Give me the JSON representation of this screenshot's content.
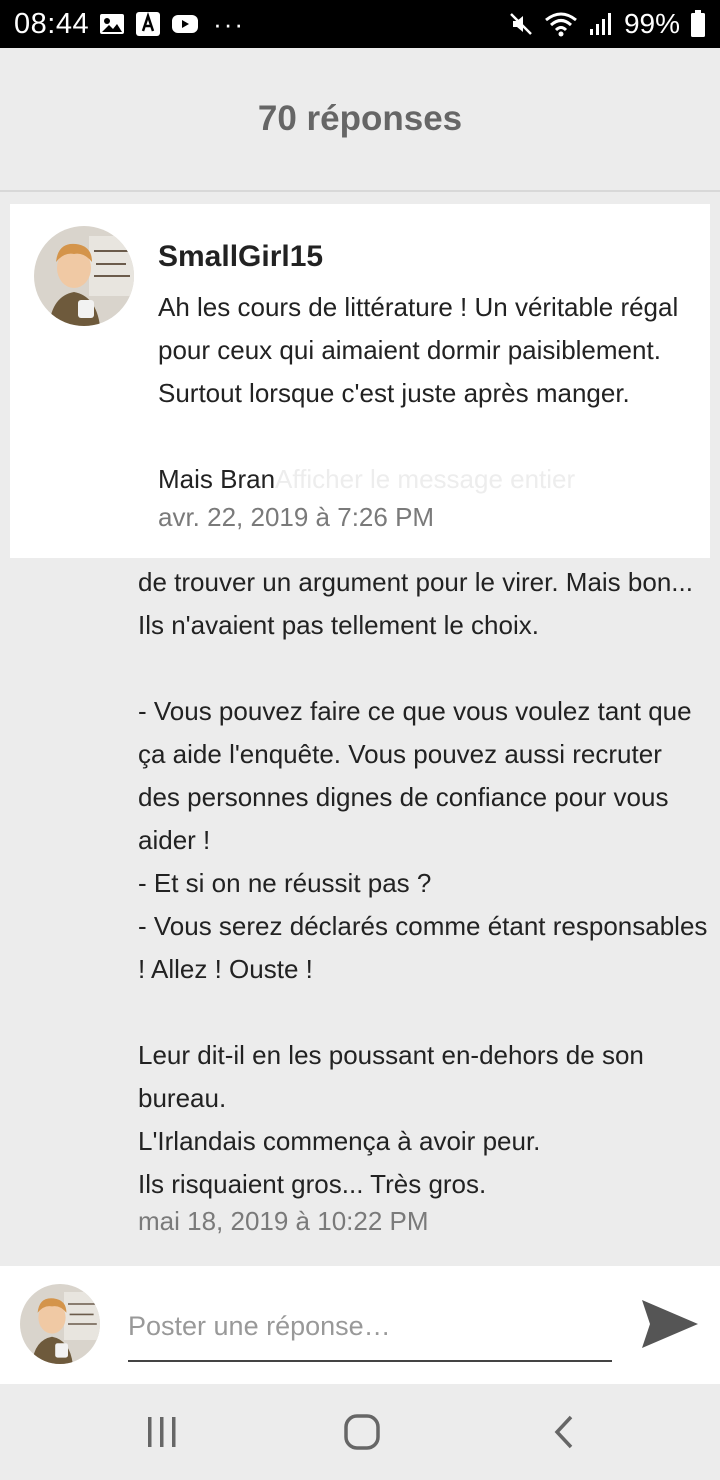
{
  "status_bar": {
    "time": "08:44",
    "battery_text": "99%",
    "overflow": "···",
    "left_icons": [
      "gallery-icon",
      "text-app-icon",
      "youtube-icon"
    ],
    "right_icons": [
      "mute-icon",
      "wifi-icon",
      "signal-icon",
      "battery-icon"
    ]
  },
  "header": {
    "title": "70 réponses"
  },
  "reply": {
    "author": "SmallGirl15",
    "body": "Ah les cours de littérature ! Un véritable régal pour ceux qui aimaient dormir paisiblement. Surtout lorsque c'est juste après manger.",
    "preview_tail": "Mais Bran",
    "more_link": "Afficher le message entier",
    "date": "avr. 22, 2019 à 7:26 PM"
  },
  "post": {
    "lines": [
      "de trouver un argument pour le virer. Mais bon... Ils n'avaient pas tellement le choix.",
      "",
      "- Vous pouvez faire ce que vous voulez tant que ça aide l'enquête. Vous pouvez aussi recruter des personnes dignes de confiance pour vous aider !",
      "- Et si on ne réussit pas ?",
      "- Vous serez déclarés comme étant responsables ! Allez ! Ouste !",
      "",
      "Leur dit-il en les poussant en-dehors de son bureau.",
      "L'Irlandais commença à avoir peur.",
      "Ils risquaient gros... Très gros."
    ],
    "date": "mai 18, 2019 à 10:22 PM"
  },
  "composer": {
    "placeholder": "Poster une réponse…",
    "value": ""
  },
  "colors": {
    "header_bg": "#ececec",
    "card_bg": "#ffffff",
    "text": "#222222",
    "muted": "#7a7a7a"
  }
}
